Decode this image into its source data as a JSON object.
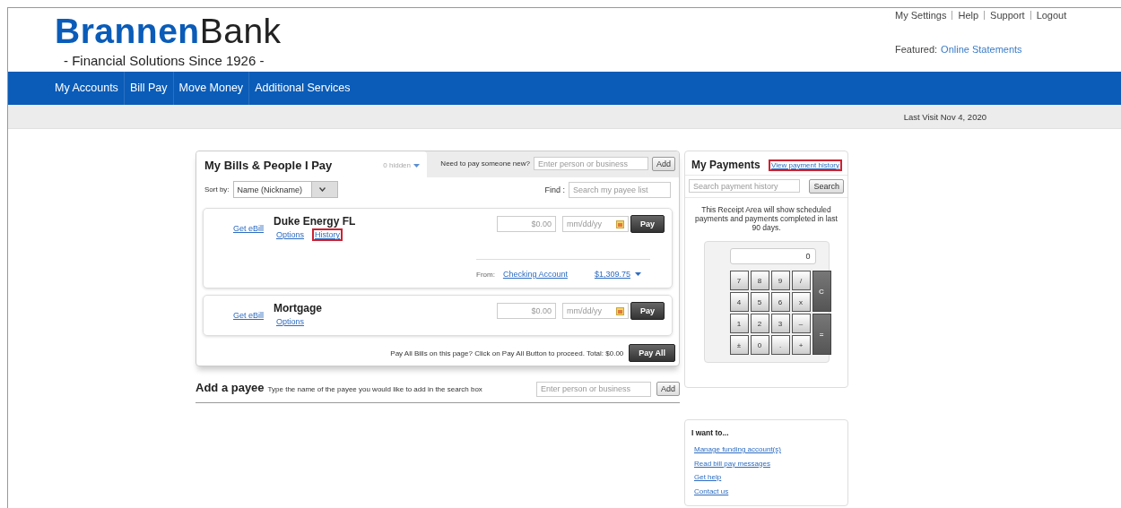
{
  "brand": {
    "name_first": "Brannen",
    "name_second": "Bank",
    "tagline": "- Financial Solutions Since 1926 -"
  },
  "top_links": [
    "My Settings",
    "Help",
    "Support",
    "Logout"
  ],
  "featured": {
    "label": "Featured:",
    "link": "Online Statements"
  },
  "nav": [
    "My Accounts",
    "Bill Pay",
    "Move Money",
    "Additional Services"
  ],
  "last_visit": "Last Visit Nov 4, 2020",
  "bills_panel": {
    "title": "My Bills & People I Pay",
    "hidden_toggle": "0 hidden",
    "new_payee_label": "Need to pay someone new?",
    "new_payee_placeholder": "Enter person or business",
    "add_button": "Add",
    "sort_label": "Sort by:",
    "sort_value": "Name (Nickname)",
    "find_label": "Find :",
    "find_placeholder": "Search my payee list",
    "payees": [
      {
        "ebill_link": "Get eBill",
        "name": "Duke Energy FL",
        "links": [
          {
            "label": "Options",
            "highlighted": false
          },
          {
            "label": "History",
            "highlighted": true
          }
        ],
        "amount_placeholder": "$0.00",
        "date_placeholder": "mm/dd/yy",
        "pay_button": "Pay",
        "from_label": "From:",
        "account": "Checking Account",
        "balance": "$1,309.75"
      },
      {
        "ebill_link": "Get eBill",
        "name": "Mortgage",
        "links": [
          {
            "label": "Options",
            "highlighted": false
          }
        ],
        "amount_placeholder": "$0.00",
        "date_placeholder": "mm/dd/yy",
        "pay_button": "Pay"
      }
    ],
    "pay_all_text": "Pay All Bills on this page? Click on Pay All Button to proceed. Total: $0.00",
    "pay_all_button": "Pay All"
  },
  "add_payee": {
    "title": "Add a payee",
    "hint": "Type the name of the payee you would like to add in the search box",
    "placeholder": "Enter person or business",
    "button": "Add"
  },
  "payments": {
    "title": "My Payments",
    "history_link": {
      "label": "View payment history",
      "highlighted": true
    },
    "search_placeholder": "Search payment history",
    "search_button": "Search",
    "notice": "This Receipt Area will show scheduled payments and payments completed in last 90 days.",
    "calculator": {
      "display": "0",
      "keys": [
        {
          "label": "7",
          "kind": "key"
        },
        {
          "label": "8",
          "kind": "key"
        },
        {
          "label": "9",
          "kind": "key"
        },
        {
          "label": "/",
          "kind": "key"
        },
        {
          "label": "C",
          "kind": "tall"
        },
        {
          "label": "4",
          "kind": "key"
        },
        {
          "label": "5",
          "kind": "key"
        },
        {
          "label": "6",
          "kind": "key"
        },
        {
          "label": "x",
          "kind": "key"
        },
        {
          "label": "1",
          "kind": "key"
        },
        {
          "label": "2",
          "kind": "key"
        },
        {
          "label": "3",
          "kind": "key"
        },
        {
          "label": "–",
          "kind": "key"
        },
        {
          "label": "=",
          "kind": "tall"
        },
        {
          "label": "±",
          "kind": "key"
        },
        {
          "label": "0",
          "kind": "key"
        },
        {
          "label": ".",
          "kind": "key"
        },
        {
          "label": "+",
          "kind": "key"
        }
      ]
    }
  },
  "i_want_to": {
    "title": "I want to...",
    "links": [
      "Manage funding account(s)",
      "Read bill pay messages",
      "Get help",
      "Contact us"
    ]
  }
}
